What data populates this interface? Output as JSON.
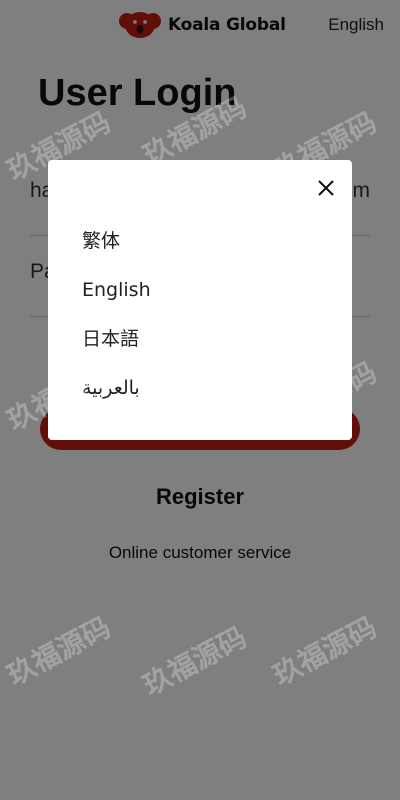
{
  "header": {
    "brand_name": "Koala Global",
    "language_label": "English"
  },
  "page": {
    "title": "User Login"
  },
  "form": {
    "username_value": "ha",
    "username_tail": "m",
    "password_placeholder": "Pa"
  },
  "links": {
    "register_label": "Register",
    "service_label": "Online customer service"
  },
  "modal": {
    "languages": [
      {
        "label": "繁体"
      },
      {
        "label": "English"
      },
      {
        "label": "日本語"
      },
      {
        "label": "بالعربية"
      }
    ]
  },
  "watermark": {
    "text": "玖福源码"
  },
  "colors": {
    "accent": "#c41f12",
    "overlay": "rgba(0,0,0,0.5)"
  }
}
